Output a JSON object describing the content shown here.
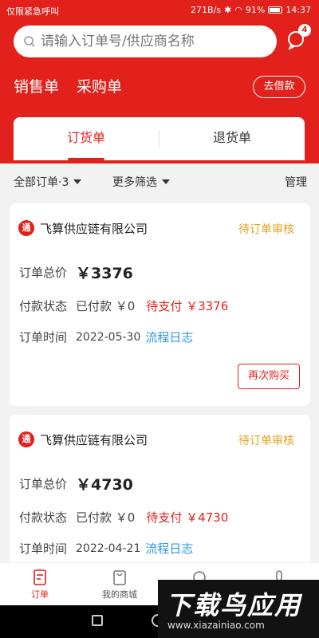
{
  "status_bar": {
    "left_text": "仅限紧急呼叫",
    "speed": "271B/s",
    "battery": "91%",
    "time": "14:37"
  },
  "search": {
    "placeholder": "请输入订单号/供应商名称"
  },
  "message": {
    "badge": "4"
  },
  "top_nav": {
    "sales": "销售单",
    "purchase": "采购单",
    "borrow_button": "去借款"
  },
  "tabs": [
    {
      "label": "订货单",
      "active": true
    },
    {
      "label": "退货单",
      "active": false
    }
  ],
  "filters": {
    "all_orders": "全部订单·3",
    "more_filters": "更多筛选",
    "manage": "管理"
  },
  "orders": [
    {
      "supplier": "飞算供应链有限公司",
      "status": "待订单审核",
      "total_label": "订单总价",
      "total": "￥3376",
      "pay_label": "付款状态",
      "paid": "已付款 ￥0",
      "pending": "待支付 ￥3376",
      "time_label": "订单时间",
      "date": "2022-05-30",
      "log_link": "流程日志",
      "rebuy_button": "再次购买"
    },
    {
      "supplier": "飞算供应链有限公司",
      "status": "待订单审核",
      "total_label": "订单总价",
      "total": "￥4730",
      "pay_label": "付款状态",
      "paid": "已付款 ￥0",
      "pending": "待支付 ￥4730",
      "time_label": "订单时间",
      "date": "2022-04-21",
      "log_link": "流程日志"
    }
  ],
  "bottom_nav": [
    {
      "label": "订单",
      "active": true
    },
    {
      "label": "我的商城",
      "active": false
    }
  ],
  "watermark": {
    "title": "下载鸟应用",
    "url": "www.xiazainiao.com"
  },
  "colors": {
    "brand_red": "#e2211c",
    "status_orange": "#e3a11b",
    "link_blue": "#2c9ae8"
  }
}
